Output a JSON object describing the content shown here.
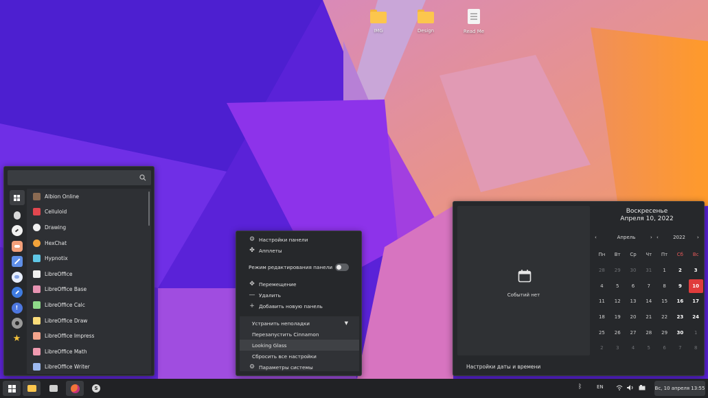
{
  "desktop": {
    "icons": [
      {
        "label": "IMG",
        "type": "folder"
      },
      {
        "label": "Design",
        "type": "folder"
      },
      {
        "label": "Read Me",
        "type": "document"
      }
    ]
  },
  "app_menu": {
    "search": {
      "value": "",
      "placeholder": ""
    },
    "categories": [
      "all-apps",
      "penguin",
      "gauge",
      "avatar",
      "pencil-ruler",
      "chat-bubble",
      "compass",
      "info",
      "gear",
      "favorites-star"
    ],
    "apps": [
      {
        "name": "Albion Online",
        "icon": "albion-icon",
        "color": "#8a6a52"
      },
      {
        "name": "Celluloid",
        "icon": "celluloid-icon",
        "color": "#e2474f"
      },
      {
        "name": "Drawing",
        "icon": "drawing-icon",
        "color": "#f1f1f1"
      },
      {
        "name": "HexChat",
        "icon": "hexchat-icon",
        "color": "#f2a33a"
      },
      {
        "name": "Hypnotix",
        "icon": "hypnotix-icon",
        "color": "#5fc7e6"
      },
      {
        "name": "LibreOffice",
        "icon": "libreoffice-icon",
        "color": "#f0f0f0"
      },
      {
        "name": "LibreOffice Base",
        "icon": "libreoffice-base-icon",
        "color": "#e793b2"
      },
      {
        "name": "LibreOffice Calc",
        "icon": "libreoffice-calc-icon",
        "color": "#8fdb8a"
      },
      {
        "name": "LibreOffice Draw",
        "icon": "libreoffice-draw-icon",
        "color": "#fbdc7a"
      },
      {
        "name": "LibreOffice Impress",
        "icon": "libreoffice-impress-icon",
        "color": "#f4a58d"
      },
      {
        "name": "LibreOffice Math",
        "icon": "libreoffice-math-icon",
        "color": "#f09ab0"
      },
      {
        "name": "LibreOffice Writer",
        "icon": "libreoffice-writer-icon",
        "color": "#9db9ef"
      }
    ]
  },
  "panel_menu": {
    "panel_settings": "Настройки панели",
    "applets": "Апплеты",
    "edit_mode": "Режим редактирования панели",
    "move": "Перемещение",
    "remove": "Удалить",
    "add_panel": "Добавить новую панель",
    "troubleshoot": "Устранить неполадки",
    "restart_cinnamon": "Перезапустить Cinnamon",
    "looking_glass": "Looking Glass",
    "reset_settings": "Сбросить все настройки",
    "system_settings": "Параметры системы"
  },
  "calendar": {
    "no_events": "Событий нет",
    "settings_link": "Настройки даты и времени",
    "weekday": "Воскресенье",
    "date": "Апреля 10, 2022",
    "month": "Апрель",
    "year": "2022",
    "weekdays": [
      "Пн",
      "Вт",
      "Ср",
      "Чт",
      "Пт",
      "Сб",
      "Вс"
    ],
    "weeks": [
      [
        "28",
        "29",
        "30",
        "31",
        "1",
        "2",
        "3"
      ],
      [
        "4",
        "5",
        "6",
        "7",
        "8",
        "9",
        "10"
      ],
      [
        "11",
        "12",
        "13",
        "14",
        "15",
        "16",
        "17"
      ],
      [
        "18",
        "19",
        "20",
        "21",
        "22",
        "23",
        "24"
      ],
      [
        "25",
        "26",
        "27",
        "28",
        "29",
        "30",
        "1"
      ],
      [
        "2",
        "3",
        "4",
        "5",
        "6",
        "7",
        "8"
      ]
    ],
    "today": "10",
    "accent": "#e03c3c"
  },
  "taskbar": {
    "language": "EN",
    "clock": "Вс, 10 апреля 13:55",
    "apps": [
      "menu-icon",
      "files-icon",
      "file-manager-icon",
      "firefox-icon",
      "skype-icon"
    ]
  }
}
